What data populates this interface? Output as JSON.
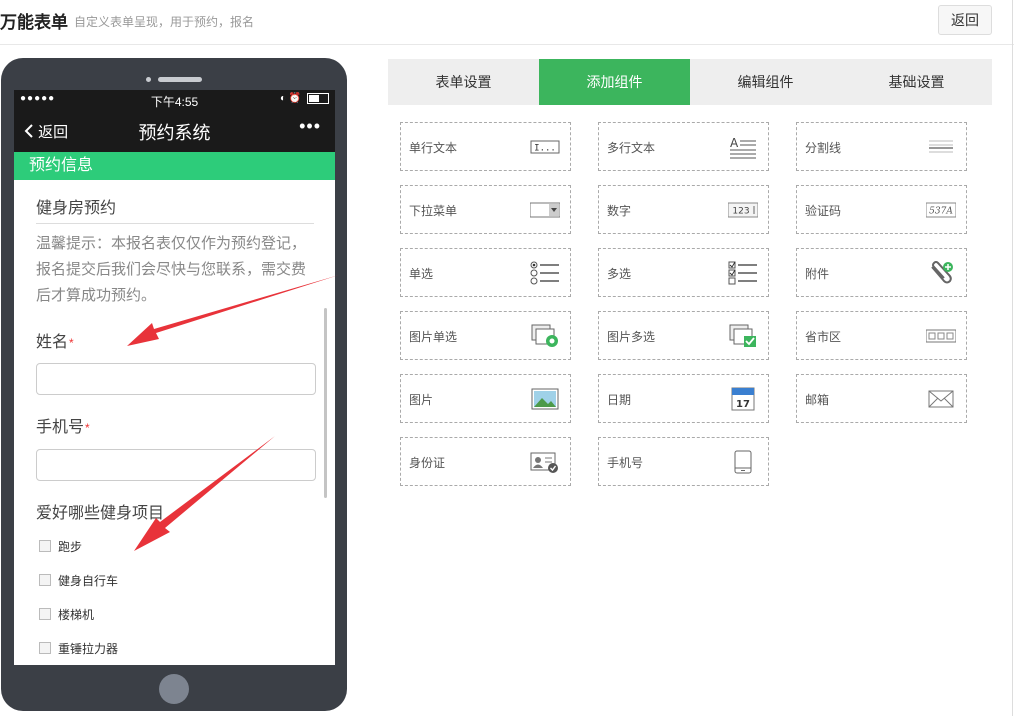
{
  "header": {
    "title": "万能表单",
    "subtitle": "自定义表单呈现，用于预约，报名",
    "back_label": "返回"
  },
  "phone": {
    "status": {
      "signal": "●●●●●",
      "time": "下午4:55",
      "icons": "◐ ⏰"
    },
    "nav": {
      "back_label": "返回",
      "title": "预约系统",
      "more": "•••"
    },
    "section_title": "预约信息",
    "form_name": "健身房预约",
    "tip": "温馨提示：本报名表仅仅作为预约登记，报名提交后我们会尽快与您联系，需交费后才算成功预约。",
    "fields": [
      {
        "label": "姓名",
        "required": "*"
      },
      {
        "label": "手机号",
        "required": "*"
      }
    ],
    "question": "爱好哪些健身项目",
    "options": [
      "跑步",
      "健身自行车",
      "楼梯机",
      "重锤拉力器"
    ]
  },
  "tabs": [
    "表单设置",
    "添加组件",
    "编辑组件",
    "基础设置"
  ],
  "active_tab": "添加组件",
  "components": [
    {
      "label": "单行文本",
      "icon": "single-line-text-icon"
    },
    {
      "label": "多行文本",
      "icon": "multi-line-text-icon"
    },
    {
      "label": "分割线",
      "icon": "divider-icon"
    },
    {
      "label": "下拉菜单",
      "icon": "dropdown-icon"
    },
    {
      "label": "数字",
      "icon": "number-icon"
    },
    {
      "label": "验证码",
      "icon": "captcha-icon"
    },
    {
      "label": "单选",
      "icon": "radio-icon"
    },
    {
      "label": "多选",
      "icon": "checkbox-icon"
    },
    {
      "label": "附件",
      "icon": "attachment-icon"
    },
    {
      "label": "图片单选",
      "icon": "image-radio-icon"
    },
    {
      "label": "图片多选",
      "icon": "image-checkbox-icon"
    },
    {
      "label": "省市区",
      "icon": "region-icon"
    },
    {
      "label": "图片",
      "icon": "image-icon"
    },
    {
      "label": "日期",
      "icon": "calendar-icon"
    },
    {
      "label": "邮箱",
      "icon": "email-icon"
    },
    {
      "label": "身份证",
      "icon": "id-card-icon"
    },
    {
      "label": "手机号",
      "icon": "mobile-icon"
    }
  ],
  "icon_text": {
    "single_line": "I...",
    "number": "123",
    "captcha": "537A",
    "calendar_day": "17"
  },
  "colors": {
    "accent": "#3cb55d",
    "section": "#2dcc7a",
    "arrow": "#e8333a",
    "phone_frame": "#3b3f46"
  }
}
